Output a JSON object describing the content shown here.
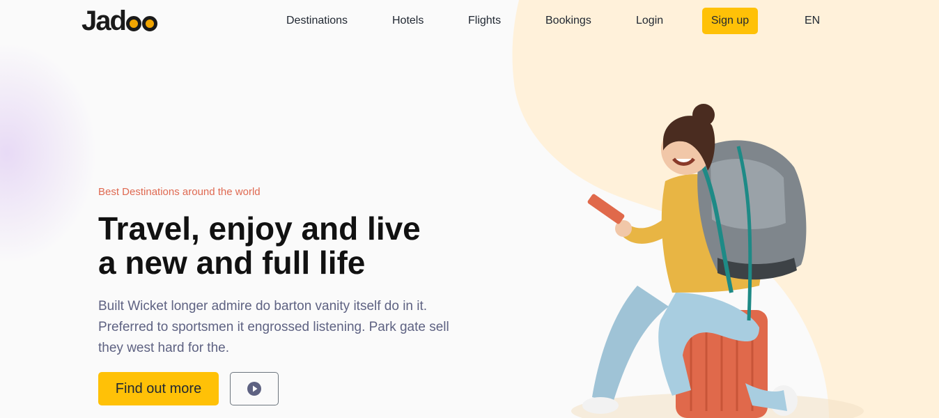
{
  "brand": {
    "name_prefix": "Jad",
    "accent": "#f1a501"
  },
  "nav": {
    "links": [
      "Destinations",
      "Hotels",
      "Flights",
      "Bookings",
      "Login"
    ],
    "signup_label": "Sign up",
    "language": "EN"
  },
  "hero": {
    "eyebrow": "Best Destinations around the world",
    "headline_line1": "Travel, enjoy and live",
    "headline_line2": "a new and full life",
    "body": "Built Wicket longer admire do barton vanity itself do in it. Preferred to sportsmen it engrossed listening. Park gate sell they west hard for the.",
    "cta_label": "Find out more",
    "play_icon": "play-circle-icon"
  },
  "colors": {
    "primary_button": "#ffc107",
    "eyebrow": "#df6951",
    "body_text": "#5e6282",
    "blob": "#fff1da"
  }
}
